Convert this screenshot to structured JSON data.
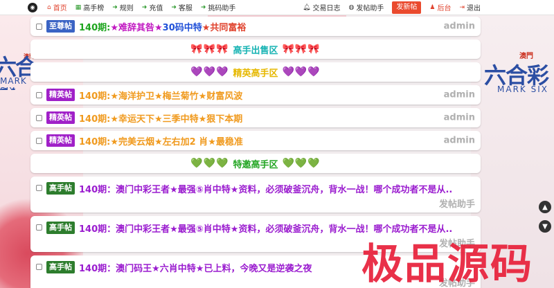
{
  "nav": {
    "items": [
      {
        "icon": "home-icon",
        "glyph": "⌂",
        "label": "首页",
        "active": true
      },
      {
        "icon": "list-icon",
        "glyph": "▦",
        "label": "高手榜"
      },
      {
        "icon": "arrow-icon",
        "glyph": "➜",
        "label": "规则"
      },
      {
        "icon": "arrow-icon",
        "glyph": "➜",
        "label": "充值"
      },
      {
        "icon": "arrow-icon",
        "glyph": "➜",
        "label": "客服"
      },
      {
        "icon": "arrow-icon",
        "glyph": "➜",
        "label": "挑码助手"
      }
    ],
    "right": {
      "log_label": "交易日志",
      "helper_label": "发帖助手",
      "post_button": "发新帖",
      "backend_label": "后台",
      "logout_label": "退出"
    }
  },
  "brand": {
    "macau": "澳門",
    "big": "六合彩",
    "small": "MARK SIX"
  },
  "rows": {
    "top": {
      "badge": "至尊帖",
      "period": "140期:",
      "p1": "★难辞其咎★",
      "p2": "30码中特",
      "p3": "★共同富裕",
      "author": "admin"
    },
    "sell_section": {
      "glyph_left": "🎀🎀🎀",
      "label": "高手出售区",
      "glyph_right": "🎀🎀🎀"
    },
    "elite_section": {
      "glyph_left": "💜💜💜",
      "label": "精英高手区",
      "glyph_right": "💜💜💜"
    },
    "elite": [
      {
        "badge": "精英帖",
        "title": "140期:★海洋护卫★梅兰菊竹★财富风波",
        "author": "admin"
      },
      {
        "badge": "精英帖",
        "title": "140期:★幸运天下★三季中特★狠下本期",
        "author": "admin"
      },
      {
        "badge": "精英帖",
        "title": "140期:★完美云烟★左右加2 肖★最稳准",
        "author": "admin"
      }
    ],
    "invite_section": {
      "glyph_left": "💚💚💚",
      "label": "特邀高手区",
      "glyph_right": "💚💚💚"
    },
    "master": [
      {
        "badge": "高手帖",
        "title": "140期：澳门中彩王者★最强⑤肖中特★资料，必须破釜沉舟，背水一战！哪个成功者不是从...",
        "author": "发帖助手"
      },
      {
        "badge": "高手帖",
        "title": "140期：澳门中彩王者★最强⑤肖中特★资料，必须破釜沉舟，背水一战！哪个成功者不是从...",
        "author": "发帖助手"
      },
      {
        "badge": "高手帖",
        "title": "140期：澳门码王★六肖中特★已上料，今晚又是逆袭之夜",
        "author": "发帖助手"
      }
    ]
  },
  "watermark": "极品源码",
  "colors": {
    "accent": "#ea4a2e",
    "badge_blue": "#3a63c4",
    "badge_purple": "#a020c8",
    "badge_green": "#2d7d2d"
  }
}
